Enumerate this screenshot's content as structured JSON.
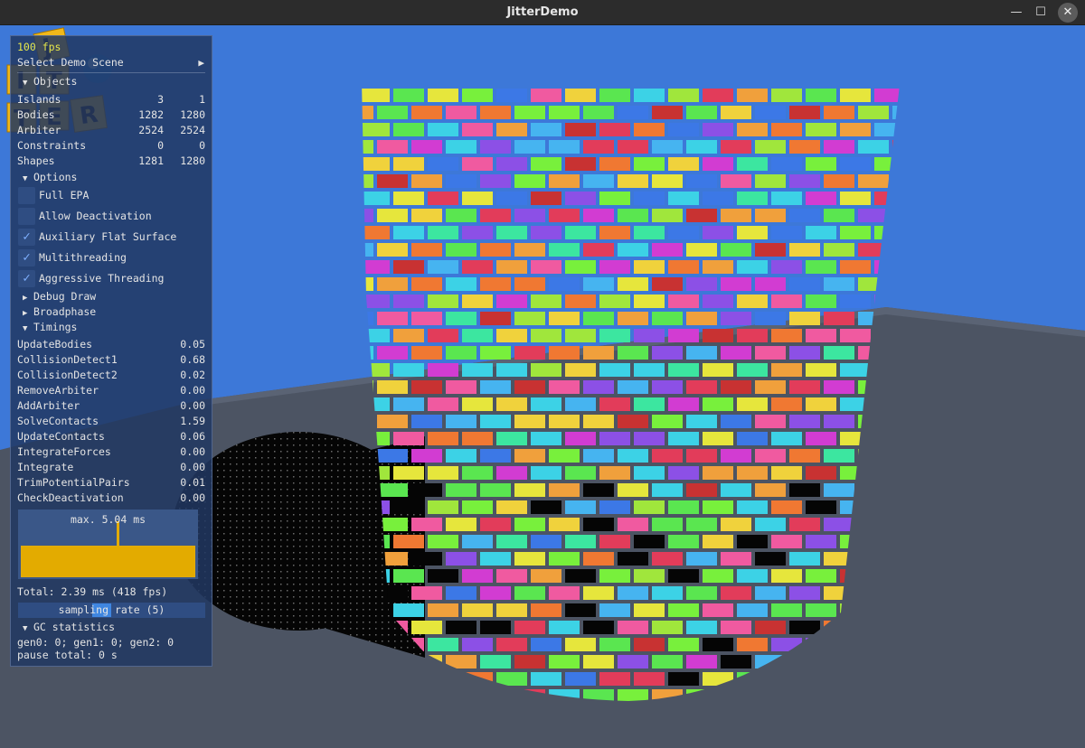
{
  "window": {
    "title": "JitterDemo",
    "minimize": "—",
    "maximize": "☐",
    "close": "✕"
  },
  "panel": {
    "fps": "100 fps",
    "select_scene": "Select Demo Scene",
    "objects": {
      "header": "Objects",
      "rows": [
        {
          "label": "Islands",
          "a": "3",
          "b": "1"
        },
        {
          "label": "Bodies",
          "a": "1282",
          "b": "1280"
        },
        {
          "label": "Arbiter",
          "a": "2524",
          "b": "2524"
        },
        {
          "label": "Constraints",
          "a": "0",
          "b": "0"
        },
        {
          "label": "Shapes",
          "a": "1281",
          "b": "1280"
        }
      ]
    },
    "options": {
      "header": "Options",
      "items": [
        {
          "label": "Full EPA",
          "checked": false
        },
        {
          "label": "Allow Deactivation",
          "checked": false
        },
        {
          "label": "Auxiliary Flat Surface",
          "checked": true
        },
        {
          "label": "Multithreading",
          "checked": true
        },
        {
          "label": "Aggressive Threading",
          "checked": true
        }
      ]
    },
    "debug_draw": "Debug Draw",
    "broadphase": "Broadphase",
    "timings": {
      "header": "Timings",
      "rows": [
        {
          "label": "UpdateBodies",
          "value": "0.05"
        },
        {
          "label": "CollisionDetect1",
          "value": "0.68"
        },
        {
          "label": "CollisionDetect2",
          "value": "0.02"
        },
        {
          "label": "RemoveArbiter",
          "value": "0.00"
        },
        {
          "label": "AddArbiter",
          "value": "0.00"
        },
        {
          "label": "SolveContacts",
          "value": "1.59"
        },
        {
          "label": "UpdateContacts",
          "value": "0.06"
        },
        {
          "label": "IntegrateForces",
          "value": "0.00"
        },
        {
          "label": "Integrate",
          "value": "0.00"
        },
        {
          "label": "TrimPotentialPairs",
          "value": "0.01"
        },
        {
          "label": "CheckDeactivation",
          "value": "0.00"
        }
      ],
      "graph_label": "max. 5.04 ms",
      "total": "Total: 2.39 ms (418 fps)",
      "sampling": "sampling rate (5)"
    },
    "gc": {
      "header": "GC statistics",
      "gens": "gen0: 0; gen1: 0; gen2: 0",
      "pause": "pause total: 0 s"
    }
  },
  "logo": {
    "letters": [
      "J",
      "I",
      "T",
      "T",
      "E",
      "R"
    ]
  },
  "colors": {
    "sky": "#3d78d8",
    "floor": "#4c5463",
    "panel": "#223862",
    "fps": "#e8e84a",
    "graph_bar": "#e3ab00",
    "check": "#7fb0ff",
    "logo_cube": "#f0b81a"
  },
  "icons": {
    "collapse": "▼",
    "expand": "▶",
    "check": "✓",
    "select_arrow": "▶"
  }
}
